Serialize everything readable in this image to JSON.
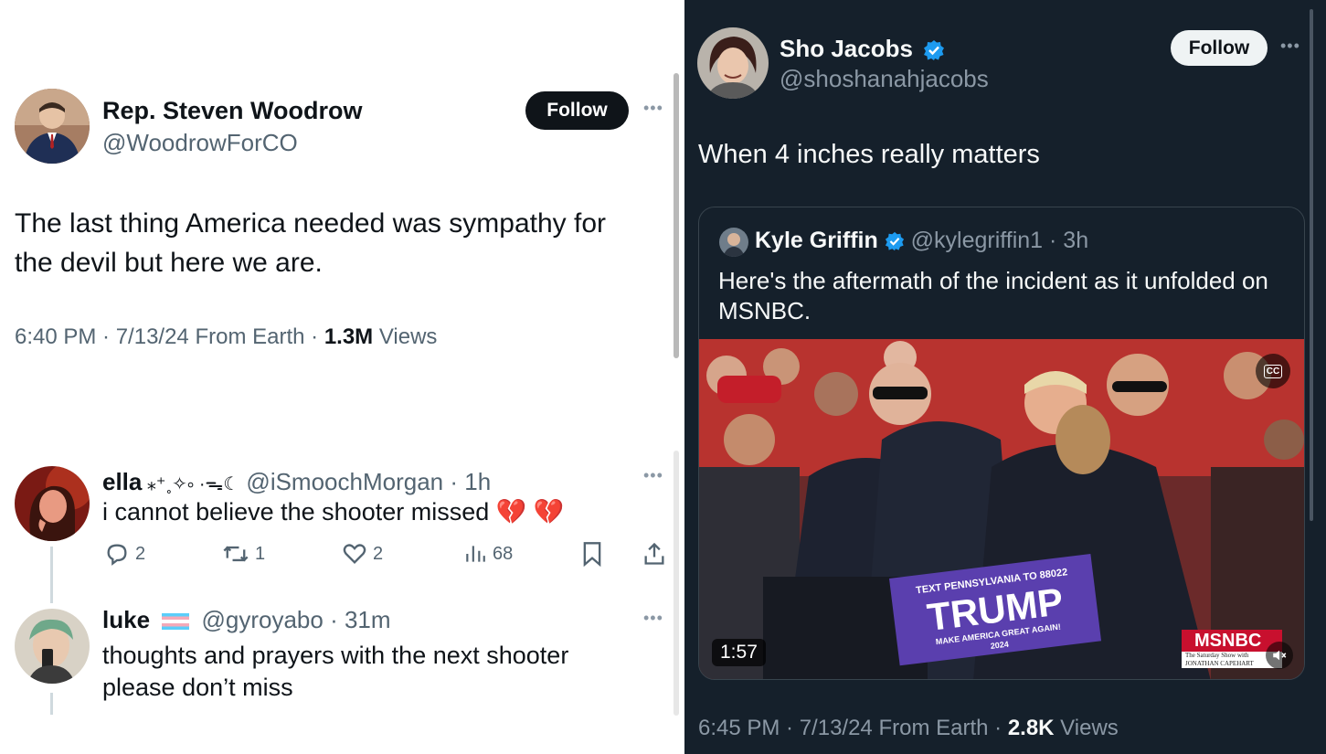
{
  "left_tweet": {
    "author_name": "Rep. Steven Woodrow",
    "handle": "@WoodrowForCO",
    "follow_label": "Follow",
    "text_line1": "The last thing America needed was sympathy for",
    "text_line2": "the devil but here we are.",
    "meta_time": "6:40 PM · 7/13/24 From Earth · ",
    "views_count": "1.3M",
    "views_label": " Views"
  },
  "replies": [
    {
      "name": "ella",
      "name_decoration": " ⁎⁺˳✧༚ ·ᯓ☾",
      "handle_time": "@iSmoochMorgan · 1h",
      "text": "i cannot believe the shooter missed 💔 💔",
      "reply_count": "2",
      "repost_count": "1",
      "like_count": "2",
      "view_count": "68"
    },
    {
      "name": "luke",
      "handle_time": "@gyroyabo · 31m",
      "text_line1": "thoughts and prayers with the next shooter",
      "text_line2": "please don’t miss"
    }
  ],
  "right_tweet": {
    "author_name": "Sho Jacobs",
    "handle": "@shoshanahjacobs",
    "follow_label": "Follow",
    "text": "When 4 inches really matters",
    "quote": {
      "author_name": "Kyle Griffin",
      "handle_time": "@kylegriffin1 · 3h",
      "text_line1": "Here's the aftermath of the incident as it unfolded on",
      "text_line2": "MSNBC.",
      "video_duration": "1:57",
      "cc_label": "CC",
      "sign_top": "TEXT PENNSYLVANIA TO 88022",
      "sign_main": "TRUMP",
      "sign_bottom1": "MAKE AMERICA GREAT AGAIN!",
      "sign_bottom2": "2024",
      "network_logo": "MSNBC",
      "network_sub": "The Saturday Show with JONATHAN CAPEHART"
    },
    "meta_time": "6:45 PM · 7/13/24 From Earth · ",
    "views_count": "2.8K",
    "views_label": " Views"
  },
  "colors": {
    "verified_blue": "#1d9bf0",
    "dark_bg": "#15202b",
    "sign_purple": "#5a3fae",
    "msnbc_red": "#c8102e"
  }
}
